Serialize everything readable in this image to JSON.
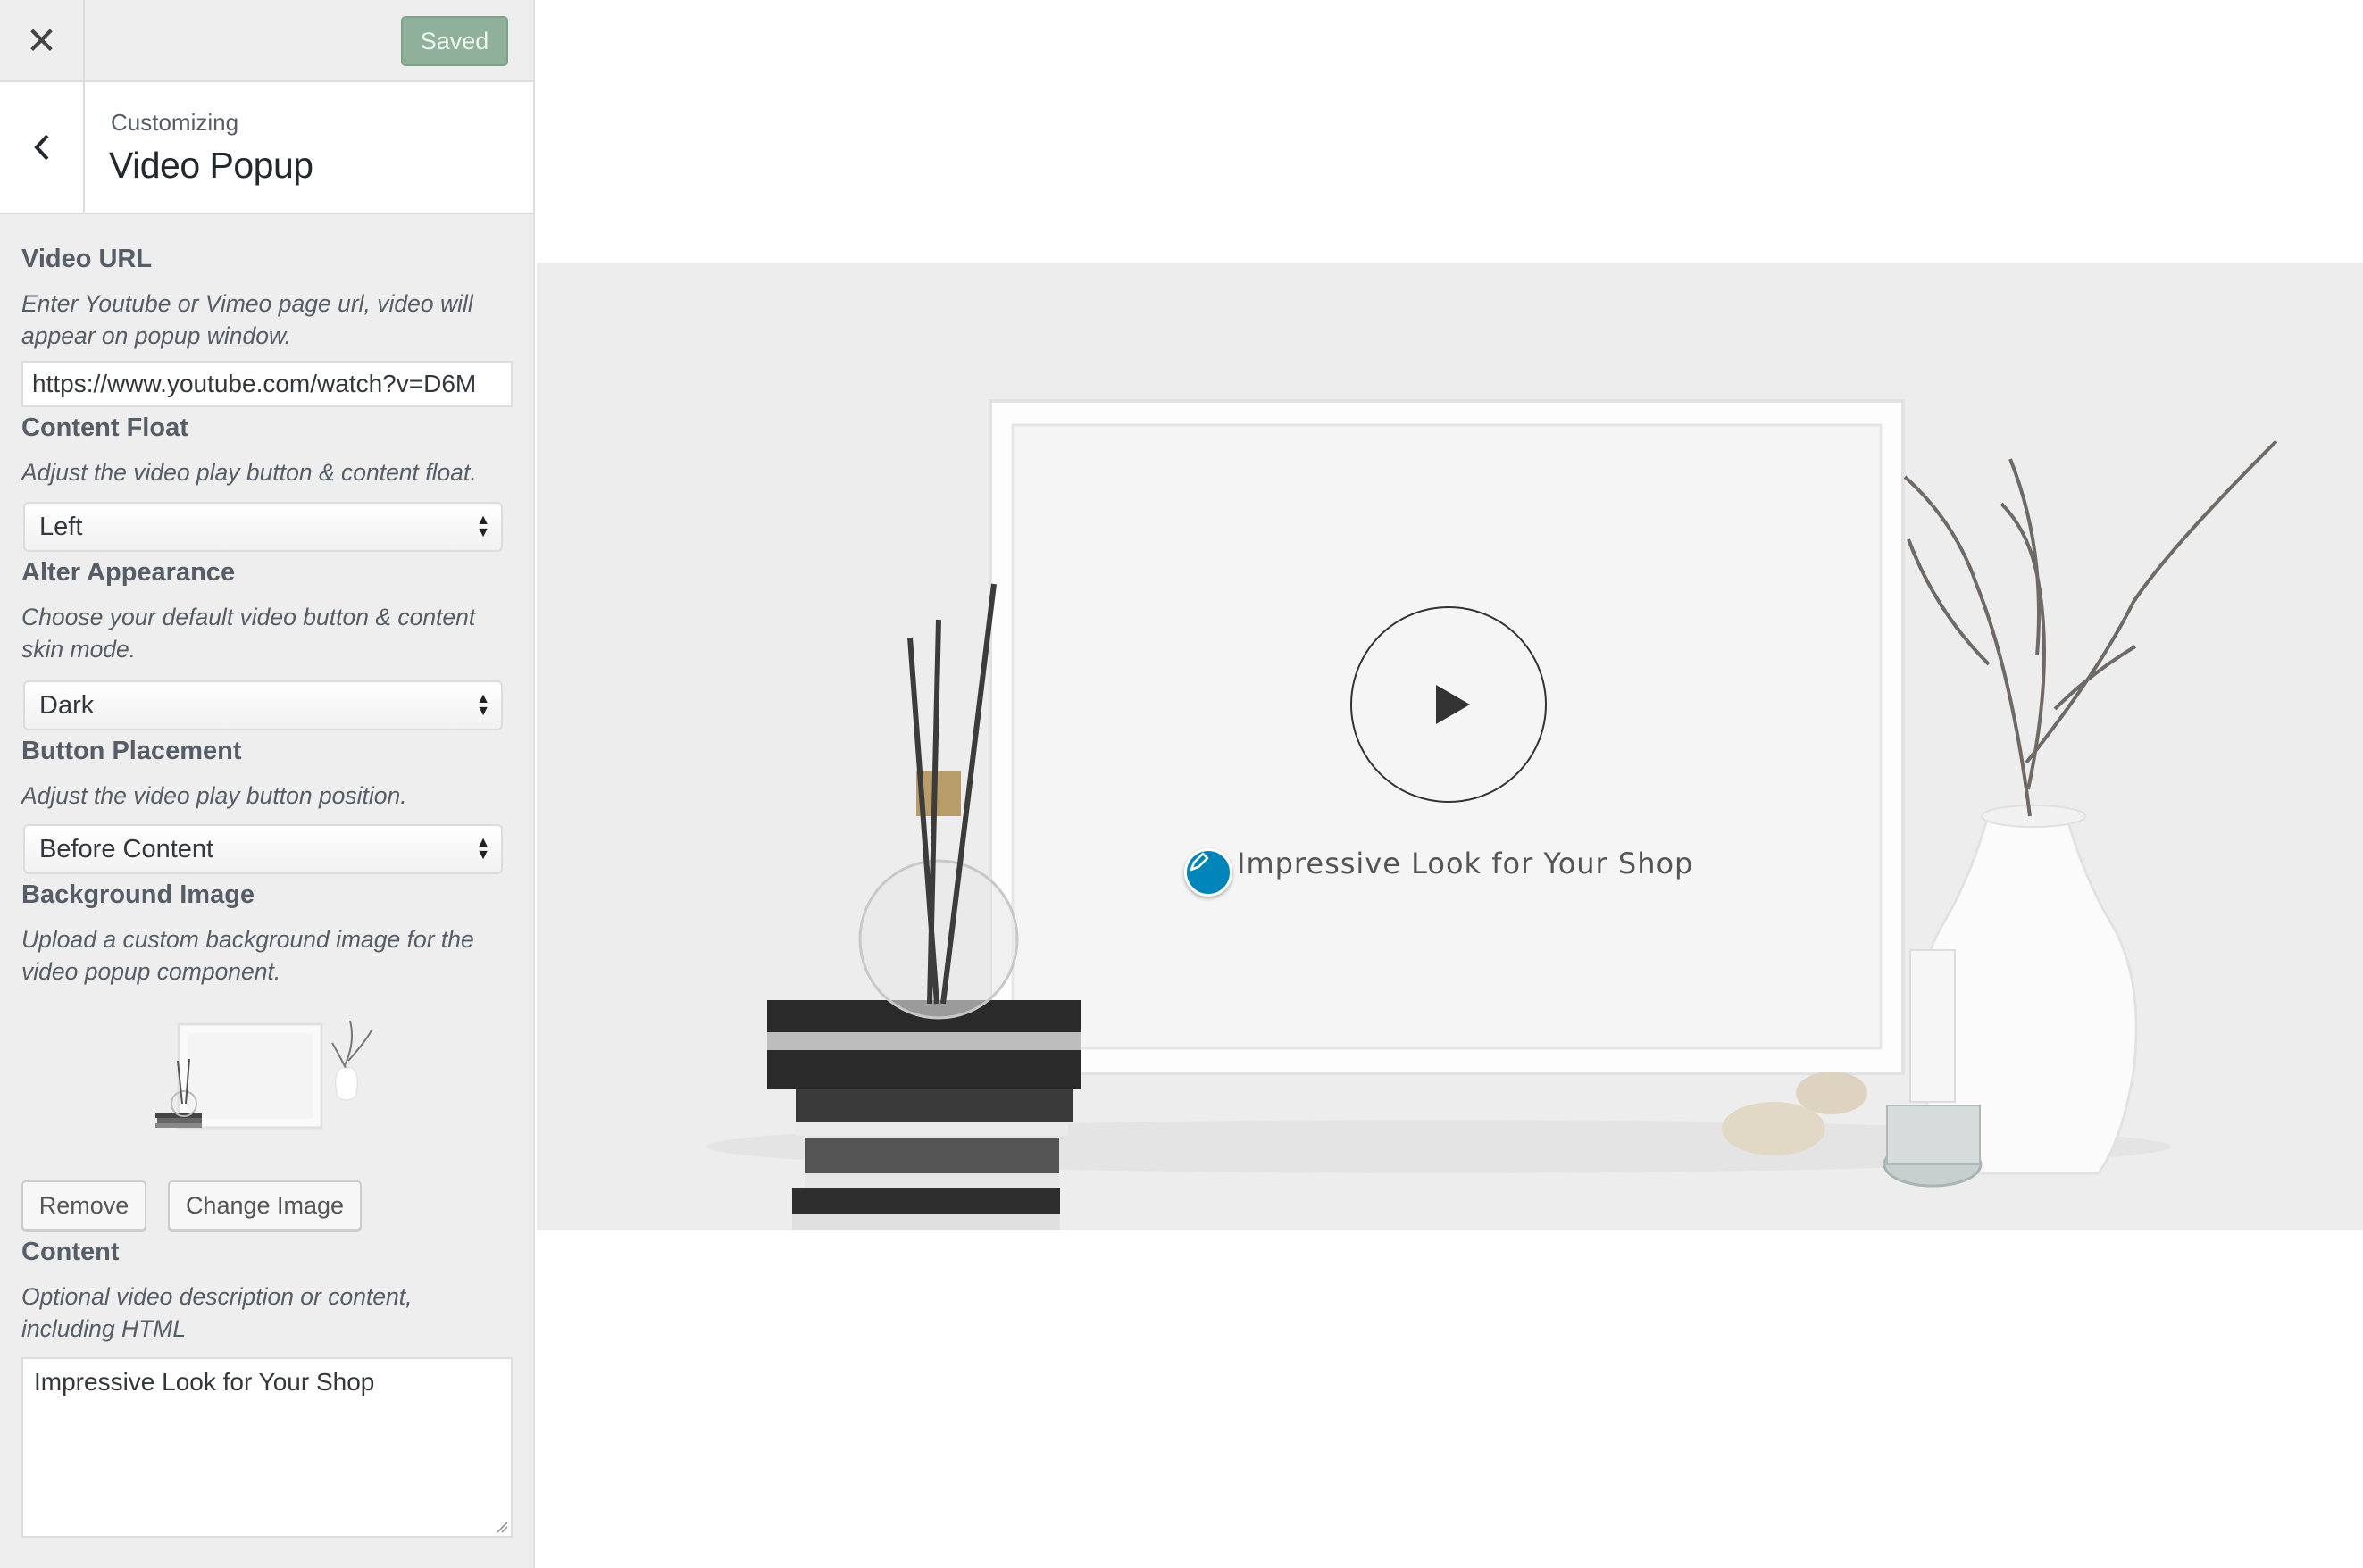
{
  "topbar": {
    "close_icon": "close-icon",
    "saved_label": "Saved",
    "saved_color": "#8fb09a"
  },
  "header": {
    "breadcrumb": "Customizing",
    "title": "Video Popup",
    "back_icon": "chevron-left-icon"
  },
  "controls": {
    "video_url": {
      "label": "Video URL",
      "description": "Enter Youtube or Vimeo page url, video will appear on popup window.",
      "value": "https://www.youtube.com/watch?v=D6M"
    },
    "content_float": {
      "label": "Content Float",
      "description": "Adjust the video play button & content float.",
      "value": "Left"
    },
    "alter_appearance": {
      "label": "Alter Appearance",
      "description": "Choose your default video button & content skin mode.",
      "value": "Dark"
    },
    "button_placement": {
      "label": "Button Placement",
      "description": "Adjust the video play button position.",
      "value": "Before Content"
    },
    "background_image": {
      "label": "Background Image",
      "description": "Upload a custom background image for the video popup component.",
      "remove_label": "Remove",
      "change_label": "Change Image"
    },
    "content": {
      "label": "Content",
      "description": "Optional video description or content, including HTML",
      "value": "Impressive Look for Your Shop"
    }
  },
  "preview": {
    "hero_text": "Impressive Look for Your Shop",
    "play_icon": "play-icon",
    "edit_icon": "pencil-icon",
    "edit_color": "#0085ba",
    "hero_bg": "#ededed"
  }
}
